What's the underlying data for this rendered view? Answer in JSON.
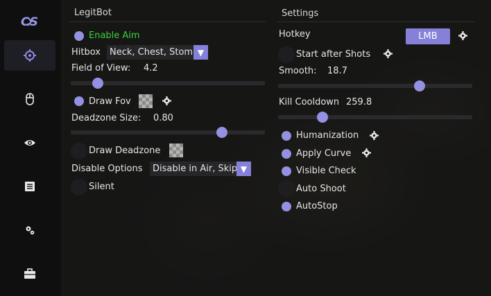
{
  "sidebar": {
    "logo": "CS",
    "items": [
      {
        "icon": "crosshair-icon",
        "active": true
      },
      {
        "icon": "mouse-icon",
        "active": false
      },
      {
        "icon": "eye-icon",
        "active": false
      },
      {
        "icon": "document-icon",
        "active": false
      },
      {
        "icon": "gears-icon",
        "active": false
      },
      {
        "icon": "briefcase-icon",
        "active": false
      }
    ]
  },
  "legitbot": {
    "title": "LegitBot",
    "enable_aim": {
      "label": "Enable Aim",
      "checked": true
    },
    "hitbox": {
      "label": "Hitbox",
      "value": "Neck, Chest, Stomach"
    },
    "fov": {
      "label": "Field of View:",
      "value": "4.2",
      "fraction": 0.14
    },
    "draw_fov": {
      "label": "Draw Fov",
      "checked": true
    },
    "deadzone": {
      "label": "Deadzone Size:",
      "value": "0.80",
      "fraction": 0.78
    },
    "draw_deadzone": {
      "label": "Draw Deadzone",
      "checked": false
    },
    "disable_options": {
      "label": "Disable Options",
      "value": "Disable in Air, Skip"
    },
    "silent": {
      "label": "Silent",
      "checked": false
    }
  },
  "settings": {
    "title": "Settings",
    "hotkey": {
      "label": "Hotkey",
      "value": "LMB"
    },
    "start_after_shots": {
      "label": "Start after Shots",
      "checked": false
    },
    "smooth": {
      "label": "Smooth:",
      "value": "18.7",
      "fraction": 0.73
    },
    "kill_cooldown": {
      "label": "Kill Cooldown",
      "value": "259.8",
      "fraction": 0.23
    },
    "humanization": {
      "label": "Humanization",
      "checked": true
    },
    "apply_curve": {
      "label": "Apply Curve",
      "checked": true
    },
    "visible_check": {
      "label": "Visible Check",
      "checked": true
    },
    "auto_shoot": {
      "label": "Auto Shoot",
      "checked": false
    },
    "autostop": {
      "label": "AutoStop",
      "checked": true
    }
  },
  "colors": {
    "accent": "#9490e2",
    "enabled_text": "#3ad43a"
  }
}
